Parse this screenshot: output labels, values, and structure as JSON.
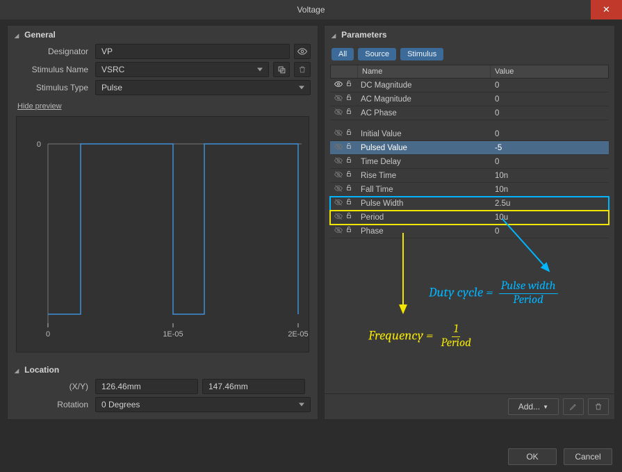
{
  "window": {
    "title": "Voltage",
    "close": "✕"
  },
  "general": {
    "header": "General",
    "designator_label": "Designator",
    "designator_value": "VP",
    "eye_icon": "👁",
    "stimulus_name_label": "Stimulus Name",
    "stimulus_name_value": "VSRC",
    "copy_icon": "⎘",
    "trash_icon": "🗑",
    "stimulus_type_label": "Stimulus Type",
    "stimulus_type_value": "Pulse",
    "hide_preview": "Hide preview"
  },
  "chart_data": {
    "type": "line",
    "title": "",
    "xlabel": "",
    "ylabel": "",
    "xlim": [
      0,
      2e-05
    ],
    "ylim": [
      -5,
      0
    ],
    "x_ticks": [
      "0",
      "1E-05",
      "2E-05"
    ],
    "y_ticks": [
      "0"
    ],
    "series": [
      {
        "name": "pulse",
        "x": [
          0,
          2.5e-06,
          2.5e-06,
          1e-05,
          1e-05,
          1.25e-05,
          1.25e-05,
          2e-05,
          2e-05
        ],
        "y": [
          -5,
          -5,
          0,
          0,
          -5,
          -5,
          0,
          0,
          -5
        ]
      }
    ]
  },
  "location": {
    "header": "Location",
    "xy_label": "(X/Y)",
    "x": "126.46mm",
    "y": "147.46mm",
    "rotation_label": "Rotation",
    "rotation_value": "0 Degrees"
  },
  "parameters": {
    "header": "Parameters",
    "chips": {
      "all": "All",
      "source": "Source",
      "stimulus": "Stimulus"
    },
    "columns": {
      "name": "Name",
      "value": "Value"
    },
    "rows_group1": [
      {
        "name": "DC Magnitude",
        "value": "0",
        "eye": true
      },
      {
        "name": "AC Magnitude",
        "value": "0",
        "eye": false
      },
      {
        "name": "AC Phase",
        "value": "0",
        "eye": false
      }
    ],
    "rows_group2": [
      {
        "name": "Initial Value",
        "value": "0",
        "eye": false,
        "sel": false,
        "hl": ""
      },
      {
        "name": "Pulsed Value",
        "value": "-5",
        "eye": false,
        "sel": true,
        "hl": ""
      },
      {
        "name": "Time Delay",
        "value": "0",
        "eye": false,
        "sel": false,
        "hl": ""
      },
      {
        "name": "Rise Time",
        "value": "10n",
        "eye": false,
        "sel": false,
        "hl": ""
      },
      {
        "name": "Fall Time",
        "value": "10n",
        "eye": false,
        "sel": false,
        "hl": ""
      },
      {
        "name": "Pulse Width",
        "value": "2.5u",
        "eye": false,
        "sel": false,
        "hl": "cyan"
      },
      {
        "name": "Period",
        "value": "10u",
        "eye": false,
        "sel": false,
        "hl": "yellow"
      },
      {
        "name": "Phase",
        "value": "0",
        "eye": false,
        "sel": false,
        "hl": ""
      }
    ],
    "add_button": "Add...",
    "edit_icon": "✎",
    "del_icon": "🗑"
  },
  "annotations": {
    "duty_label": "Duty cycle =",
    "duty_num": "Pulse width",
    "duty_den": "Period",
    "freq_label": "Frequency =",
    "freq_num": "1",
    "freq_den": "Period"
  },
  "footer": {
    "ok": "OK",
    "cancel": "Cancel"
  }
}
